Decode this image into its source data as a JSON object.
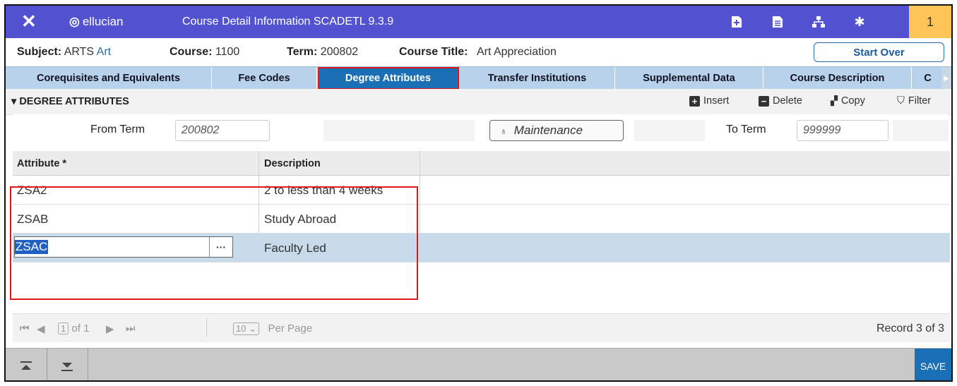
{
  "header": {
    "brand": "ellucian",
    "title": "Course Detail Information SCADETL 9.3.9",
    "notification_count": "1"
  },
  "keyblock": {
    "subject_label": "Subject:",
    "subject_value": "ARTS",
    "subject_desc": "Art",
    "course_label": "Course:",
    "course_value": "1100",
    "term_label": "Term:",
    "term_value": "200802",
    "title_label": "Course Title:",
    "title_value": "Art Appreciation",
    "start_over": "Start Over"
  },
  "tabs": [
    {
      "label": "Corequisites and Equivalents"
    },
    {
      "label": "Fee Codes"
    },
    {
      "label": "Degree Attributes"
    },
    {
      "label": "Transfer Institutions"
    },
    {
      "label": "Supplemental Data"
    },
    {
      "label": "Course Description"
    },
    {
      "label": "C"
    }
  ],
  "section": {
    "title": "DEGREE ATTRIBUTES",
    "insert": "Insert",
    "delete": "Delete",
    "copy": "Copy",
    "filter": "Filter"
  },
  "filters": {
    "from_term_label": "From Term",
    "from_term_value": "200802",
    "maintenance": "Maintenance",
    "to_term_label": "To Term",
    "to_term_value": "999999"
  },
  "grid": {
    "columns": [
      "Attribute *",
      "Description"
    ],
    "rows": [
      {
        "attribute": "ZSA2",
        "description": "2 to less than 4 weeks"
      },
      {
        "attribute": "ZSAB",
        "description": "Study Abroad"
      },
      {
        "attribute": "ZSAC",
        "description": "Faculty Led"
      }
    ]
  },
  "pager": {
    "page": "1",
    "of": "of 1",
    "per_page_value": "10",
    "per_page_label": "Per Page",
    "record": "Record 3 of 3"
  },
  "footer": {
    "save": "SAVE"
  },
  "colors": {
    "header_bg": "#5353d1",
    "accent": "#1b6fb5",
    "notification_bg": "#fdc558",
    "highlight_border": "#e01818"
  }
}
